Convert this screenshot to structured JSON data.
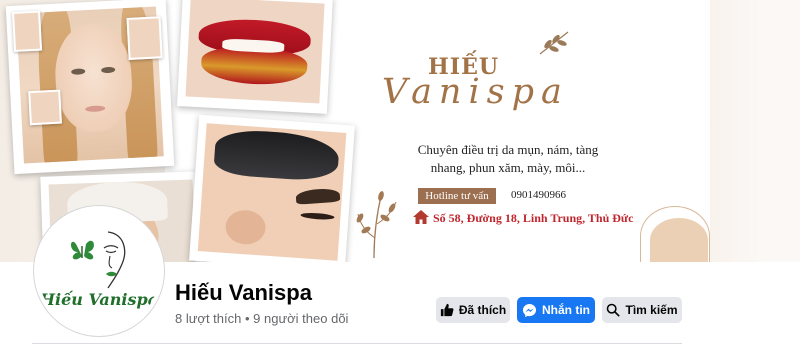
{
  "cover": {
    "brand_line1": "HIẾU",
    "brand_line2": "Vanispa",
    "tagline_line1": "Chuyên điều trị da mụn, nám, tàng",
    "tagline_line2": "nhang, phun xăm, mày, môi...",
    "hotline_label": "Hotline tư vấn",
    "hotline_number": "0901490966",
    "address": "Số 58, Đường 18, Linh Trung, Thủ Đức"
  },
  "profile": {
    "avatar_text": "Hiếu Vanispa",
    "name": "Hiếu Vanispa",
    "stats": "8 lượt thích • 9 người theo dõi"
  },
  "actions": {
    "like_label": "Đã thích",
    "message_label": "Nhắn tin",
    "search_label": "Tìm kiếm"
  },
  "icons": {
    "like": "thumbs-up-icon",
    "message": "messenger-icon",
    "search": "search-icon",
    "address": "house-icon"
  },
  "colors": {
    "brand_brown": "#a37348",
    "hotline_bg": "#9b6f4f",
    "address_red": "#c0262d",
    "messenger_blue": "#1877f2",
    "button_gray": "#e4e6eb",
    "avatar_green": "#1f6e2a"
  }
}
